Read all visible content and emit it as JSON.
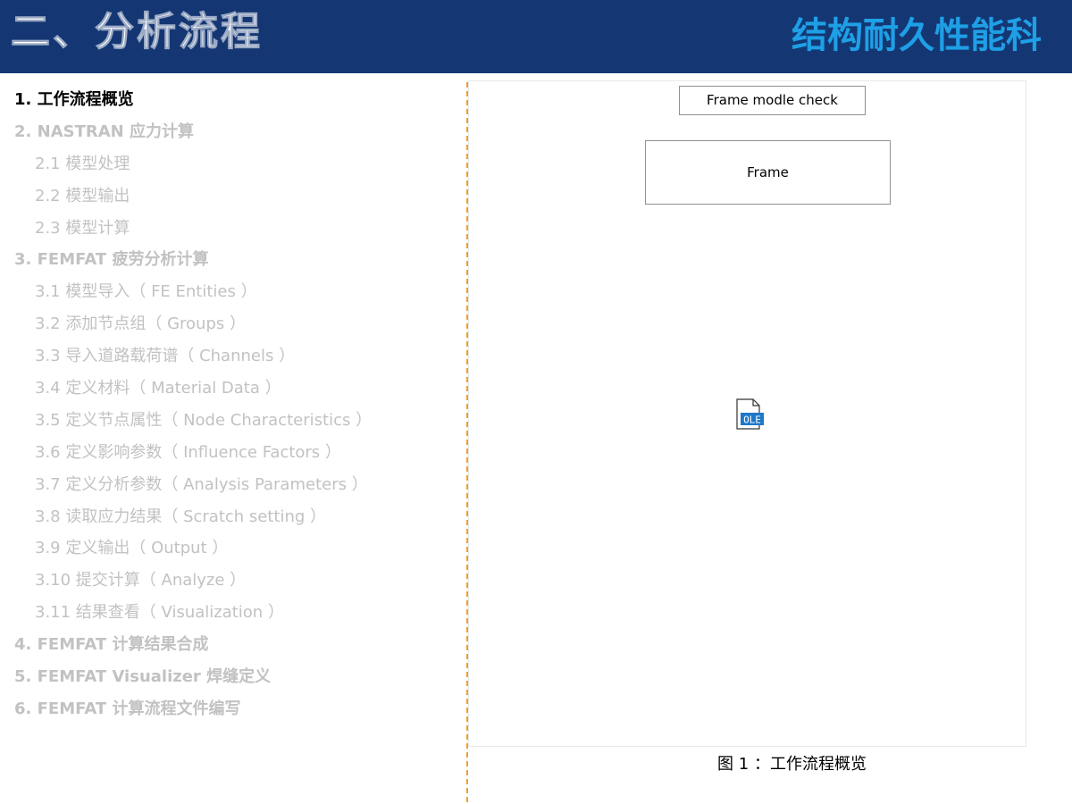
{
  "header": {
    "title": "二、分析流程",
    "brand": "结构耐久性能科",
    "background_color": "#143773",
    "brand_color": "#1e9fe6"
  },
  "toc": {
    "items": [
      {
        "label": "1.  工作流程概览",
        "level": 1,
        "active": true
      },
      {
        "label": "2. NASTRAN 应力计算",
        "level": 1,
        "active": false
      },
      {
        "label": "2.1  模型处理",
        "level": 2,
        "active": false
      },
      {
        "label": "2.2  模型输出",
        "level": 2,
        "active": false
      },
      {
        "label": "2.3  模型计算",
        "level": 2,
        "active": false
      },
      {
        "label": "3. FEMFAT 疲劳分析计算",
        "level": 1,
        "active": false
      },
      {
        "label": "3.1  模型导入（ FE Entities ）",
        "level": 2,
        "active": false
      },
      {
        "label": "3.2  添加节点组（ Groups ）",
        "level": 2,
        "active": false
      },
      {
        "label": "3.3  导入道路载荷谱（ Channels ）",
        "level": 2,
        "active": false
      },
      {
        "label": "3.4  定义材料（ Material Data ）",
        "level": 2,
        "active": false
      },
      {
        "label": "3.5  定义节点属性（ Node Characteristics ）",
        "level": 2,
        "active": false
      },
      {
        "label": "3.6  定义影响参数（ Influence Factors ）",
        "level": 2,
        "active": false
      },
      {
        "label": "3.7  定义分析参数（ Analysis Parameters ）",
        "level": 2,
        "active": false
      },
      {
        "label": "3.8  读取应力结果（ Scratch setting ）",
        "level": 2,
        "active": false
      },
      {
        "label": "3.9  定义输出（ Output ）",
        "level": 2,
        "active": false
      },
      {
        "label": "3.10  提交计算（ Analyze ）",
        "level": 2,
        "active": false
      },
      {
        "label": "3.11   结果查看（ Visualization ）",
        "level": 2,
        "active": false
      },
      {
        "label": "4. FEMFAT 计算结果合成",
        "level": 1,
        "active": false
      },
      {
        "label": "5. FEMFAT Visualizer  焊缝定义",
        "level": 1,
        "active": false
      },
      {
        "label": "6. FEMFAT 计算流程文件编写",
        "level": 1,
        "active": false
      }
    ]
  },
  "figure": {
    "check_label": "Frame modle check",
    "frame_label": "Frame",
    "icon": "ole-object-icon",
    "icon_text": "OLE",
    "caption": "图 1 ：工作流程概览"
  }
}
